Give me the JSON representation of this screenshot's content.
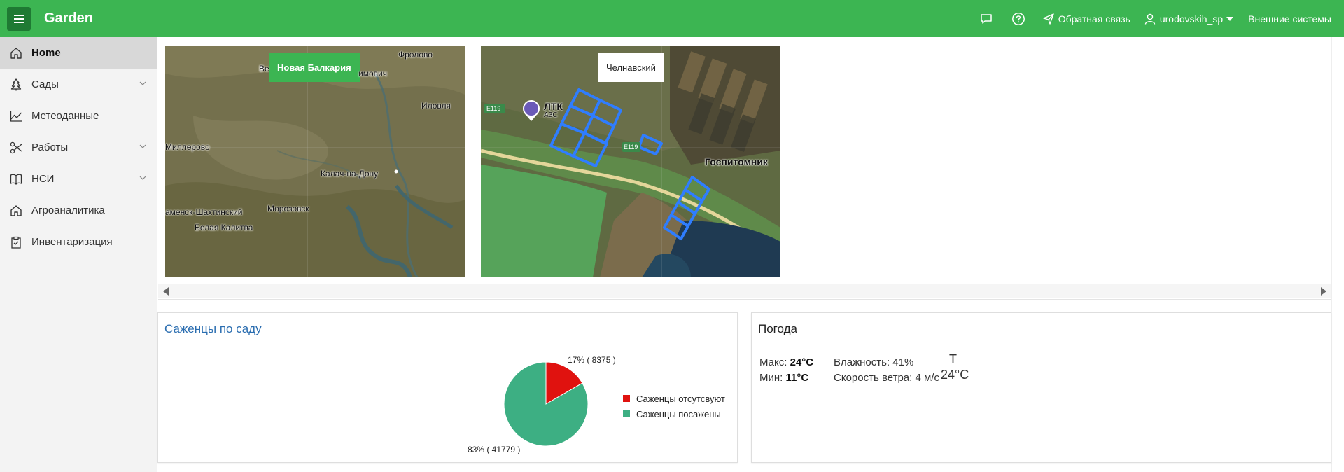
{
  "header": {
    "app_title": "Garden",
    "menu_icon": "hamburger-icon",
    "feedback": "Обратная связь",
    "user": "urodovskih_sp",
    "external": "Внешние системы"
  },
  "sidebar": {
    "items": [
      {
        "label": "Home",
        "icon": "home-icon",
        "active": true
      },
      {
        "label": "Сады",
        "icon": "tree-icon",
        "expandable": true
      },
      {
        "label": "Метеоданные",
        "icon": "chart-line-icon"
      },
      {
        "label": "Работы",
        "icon": "scissors-icon",
        "expandable": true
      },
      {
        "label": "НСИ",
        "icon": "book-icon",
        "expandable": true
      },
      {
        "label": "Агроаналитика",
        "icon": "home-icon"
      },
      {
        "label": "Инвентаризация",
        "icon": "clipboard-icon"
      }
    ]
  },
  "maps": [
    {
      "garden_name": "Новая Балкария",
      "labels": [
        "Фролово",
        "имович",
        "Иловля",
        "Ве",
        "Миллерово",
        "Калач-на-Дону",
        "аменск-Шахтинский",
        "Морозовск",
        "Белая Калитва"
      ]
    },
    {
      "garden_name": "Челнавский",
      "labels": [
        "ЛТК",
        "АЗС",
        "E119",
        "E119",
        "Госпитомник"
      ]
    }
  ],
  "seedlings_card": {
    "title": "Саженцы по саду",
    "slice_labels": [
      "17% ( 8375 )",
      "83% ( 41779 )"
    ],
    "legend": [
      "Саженцы отсутсвуют",
      "Саженцы посажены"
    ]
  },
  "weather_card": {
    "title": "Погода",
    "max_label": "Макс:",
    "max_value": "24°C",
    "min_label": "Мин:",
    "min_value": "11°C",
    "humidity": "Влажность: 41%",
    "wind": "Скорость ветра: 4 м/с",
    "t_label": "T",
    "t_value": "24°C"
  },
  "chart_data": {
    "type": "pie",
    "title": "Саженцы по саду",
    "series": [
      {
        "name": "Саженцы отсутсвуют",
        "value": 8375,
        "percent": 17,
        "color": "#e0120f"
      },
      {
        "name": "Саженцы посажены",
        "value": 41779,
        "percent": 83,
        "color": "#3daf83"
      }
    ],
    "legend_position": "right"
  },
  "colors": {
    "brand": "#3cb552",
    "menu_button": "#1f7a33",
    "link": "#2a6db0"
  }
}
